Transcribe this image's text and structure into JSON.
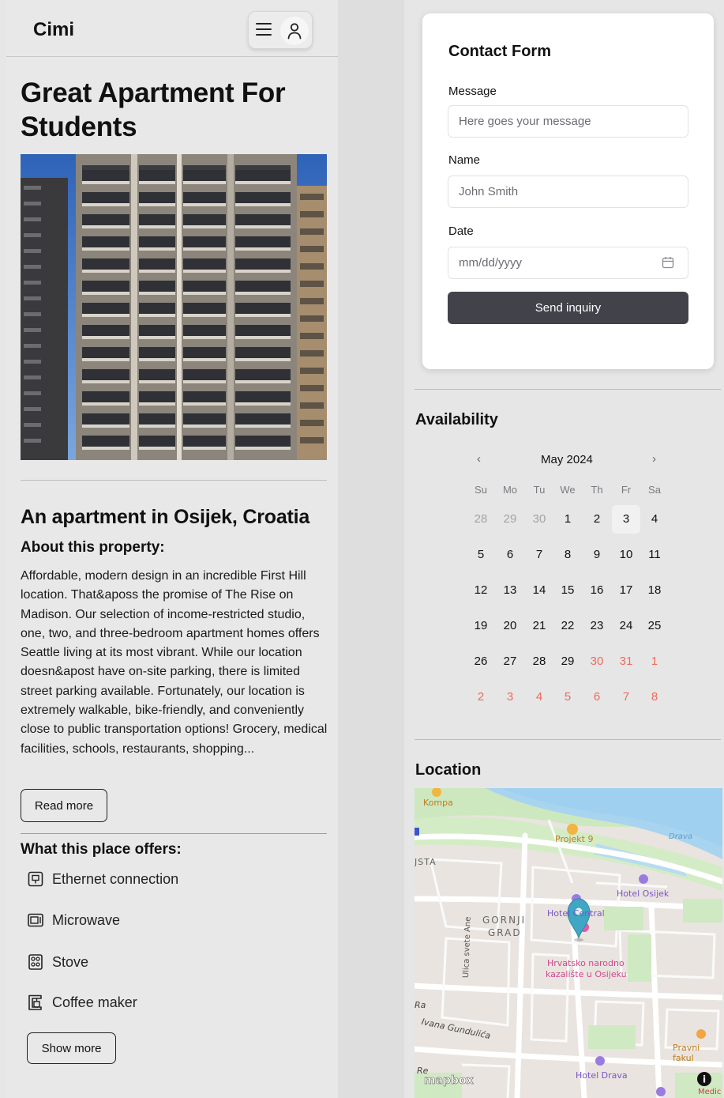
{
  "header": {
    "brand": "Cimi",
    "menu_icon": "hamburger-icon",
    "user_icon": "user-icon"
  },
  "listing": {
    "title": "Great Apartment For Students",
    "subtitle": "An apartment in Osijek, Croatia",
    "about_heading": "About this property:",
    "about_text": "Affordable, modern design in an incredible First Hill location. That&aposs the promise of The Rise on Madison. Our selection of income-restricted studio, one, two, and three-bedroom apartment homes offers Seattle living at its most vibrant. While our location doesn&apost have on-site parking, there is limited street parking available. Fortunately, our location is extremely walkable, bike-friendly, and conveniently close to public transportation options! Grocery, medical facilities, schools, restaurants, shopping...",
    "read_more_label": "Read more",
    "offers_heading": "What this place offers:",
    "offers": [
      {
        "label": "Ethernet connection",
        "icon": "ethernet-icon"
      },
      {
        "label": "Microwave",
        "icon": "microwave-icon"
      },
      {
        "label": "Stove",
        "icon": "stove-icon"
      },
      {
        "label": "Coffee maker",
        "icon": "coffee-maker-icon"
      }
    ],
    "show_more_label": "Show more"
  },
  "contact_form": {
    "title": "Contact Form",
    "message_label": "Message",
    "message_placeholder": "Here goes your message",
    "name_label": "Name",
    "name_placeholder": "John Smith",
    "date_label": "Date",
    "date_placeholder": "mm/dd/yyyy",
    "submit_label": "Send inquiry"
  },
  "availability": {
    "heading": "Availability",
    "month": "May 2024",
    "prev": "‹",
    "next": "›",
    "weekdays": [
      "Su",
      "Mo",
      "Tu",
      "We",
      "Th",
      "Fr",
      "Sa"
    ],
    "weeks": [
      [
        {
          "d": "28",
          "s": "muted"
        },
        {
          "d": "29",
          "s": "muted"
        },
        {
          "d": "30",
          "s": "muted"
        },
        {
          "d": "1",
          "s": ""
        },
        {
          "d": "2",
          "s": ""
        },
        {
          "d": "3",
          "s": "today"
        },
        {
          "d": "4",
          "s": ""
        }
      ],
      [
        {
          "d": "5",
          "s": ""
        },
        {
          "d": "6",
          "s": ""
        },
        {
          "d": "7",
          "s": ""
        },
        {
          "d": "8",
          "s": ""
        },
        {
          "d": "9",
          "s": ""
        },
        {
          "d": "10",
          "s": ""
        },
        {
          "d": "11",
          "s": ""
        }
      ],
      [
        {
          "d": "12",
          "s": ""
        },
        {
          "d": "13",
          "s": ""
        },
        {
          "d": "14",
          "s": ""
        },
        {
          "d": "15",
          "s": ""
        },
        {
          "d": "16",
          "s": ""
        },
        {
          "d": "17",
          "s": ""
        },
        {
          "d": "18",
          "s": ""
        }
      ],
      [
        {
          "d": "19",
          "s": ""
        },
        {
          "d": "20",
          "s": ""
        },
        {
          "d": "21",
          "s": ""
        },
        {
          "d": "22",
          "s": ""
        },
        {
          "d": "23",
          "s": ""
        },
        {
          "d": "24",
          "s": ""
        },
        {
          "d": "25",
          "s": ""
        }
      ],
      [
        {
          "d": "26",
          "s": ""
        },
        {
          "d": "27",
          "s": ""
        },
        {
          "d": "28",
          "s": ""
        },
        {
          "d": "29",
          "s": ""
        },
        {
          "d": "30",
          "s": "red"
        },
        {
          "d": "31",
          "s": "red"
        },
        {
          "d": "1",
          "s": "red"
        }
      ],
      [
        {
          "d": "2",
          "s": "red"
        },
        {
          "d": "3",
          "s": "red"
        },
        {
          "d": "4",
          "s": "red"
        },
        {
          "d": "5",
          "s": "red"
        },
        {
          "d": "6",
          "s": "red"
        },
        {
          "d": "7",
          "s": "red"
        },
        {
          "d": "8",
          "s": "red"
        }
      ]
    ]
  },
  "location": {
    "heading": "Location",
    "map_labels": {
      "kompa": "Kompa",
      "projekt": "Projekt 9",
      "drava": "Drava",
      "jsta": "JSTA",
      "hotel_osijek": "Hotel Osijek",
      "hotel_central": "Hotel Central",
      "gornji": "GORNJI",
      "grad": "GRAD",
      "hnk1": "Hrvatsko narodno",
      "hnk2": "kazalište u Osijeku",
      "ulica": "Ulica svete Ane",
      "ivana": "Ivana Gundulića",
      "pravni": "Pravni fakul",
      "hotel_drava": "Hotel Drava",
      "medic": "Medic",
      "mapbox": "mapbox",
      "ra": "Ra",
      "re": "Re"
    }
  }
}
